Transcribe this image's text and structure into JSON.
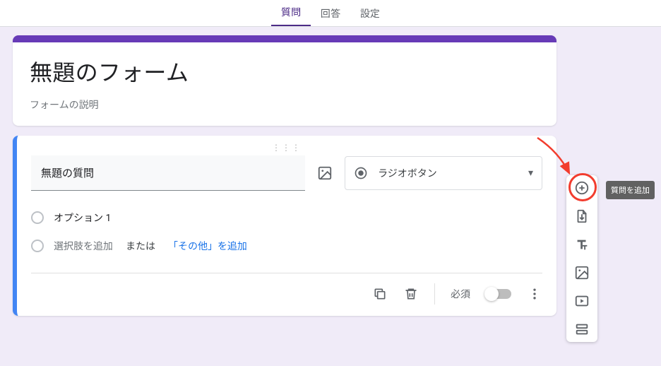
{
  "tabs": {
    "questions": "質問",
    "responses": "回答",
    "settings": "設定"
  },
  "header": {
    "title": "無題のフォーム",
    "description": "フォームの説明"
  },
  "question": {
    "title": "無題の質問",
    "type_label": "ラジオボタン",
    "option1": "オプション 1",
    "add_option": "選択肢を追加",
    "or": "または",
    "add_other": "「その他」を追加",
    "required_label": "必須"
  },
  "side": {
    "add_question_tooltip": "質問を追加",
    "icons": {
      "add": "add-question",
      "import": "import-questions",
      "title": "add-title",
      "image": "add-image",
      "video": "add-video",
      "section": "add-section"
    }
  }
}
